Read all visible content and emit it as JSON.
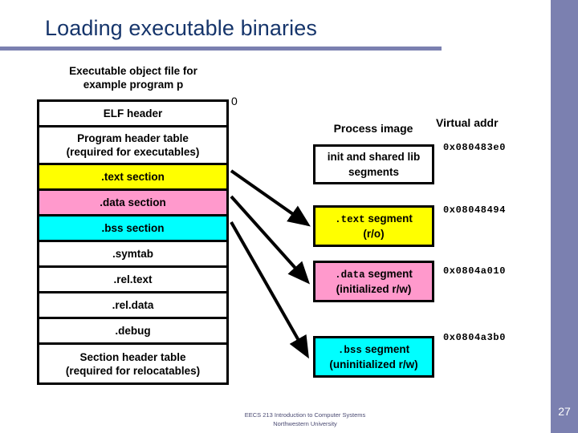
{
  "slide": {
    "title": "Loading executable binaries",
    "page_number": "27",
    "accent_color": "#7b80b0",
    "title_color": "#16356b"
  },
  "object_file": {
    "caption_line1": "Executable object file for",
    "caption_line2": "example program p",
    "offset_label": "0",
    "rows": [
      {
        "label": "ELF header",
        "label2": "",
        "fill": "#ffffff",
        "tall": false
      },
      {
        "label": "Program header table",
        "label2": "(required for executables)",
        "fill": "#ffffff",
        "tall": true
      },
      {
        "label": ".text section",
        "label2": "",
        "fill": "#ffff00",
        "tall": false
      },
      {
        "label": ".data section",
        "label2": "",
        "fill": "#ff99cc",
        "tall": false
      },
      {
        "label": ".bss section",
        "label2": "",
        "fill": "#00ffff",
        "tall": false
      },
      {
        "label": ".symtab",
        "label2": "",
        "fill": "#ffffff",
        "tall": false
      },
      {
        "label": ".rel.text",
        "label2": "",
        "fill": "#ffffff",
        "tall": false
      },
      {
        "label": ".rel.data",
        "label2": "",
        "fill": "#ffffff",
        "tall": false
      },
      {
        "label": ".debug",
        "label2": "",
        "fill": "#ffffff",
        "tall": false
      },
      {
        "label": "Section header table",
        "label2": "(required for relocatables)",
        "fill": "#ffffff",
        "tall": true
      }
    ]
  },
  "process_image": {
    "heading": "Process image",
    "vaddr_heading": "Virtual addr",
    "segments": [
      {
        "mono_part": "",
        "text_part": "init and shared lib",
        "line2": "segments",
        "fill": "#ffffff",
        "vaddr": "0x080483e0"
      },
      {
        "mono_part": ".text",
        "text_part": " segment",
        "line2": "(r/o)",
        "fill": "#ffff00",
        "vaddr": "0x08048494"
      },
      {
        "mono_part": ".data",
        "text_part": " segment",
        "line2": "(initialized r/w)",
        "fill": "#ff99cc",
        "vaddr": "0x0804a010"
      },
      {
        "mono_part": ".bss",
        "text_part": " segment",
        "line2": "(uninitialized r/w)",
        "fill": "#00ffff",
        "vaddr": "0x0804a3b0"
      }
    ]
  },
  "footer": {
    "line1": "EECS 213 Introduction to Computer Systems",
    "line2": "Northwestern University"
  }
}
